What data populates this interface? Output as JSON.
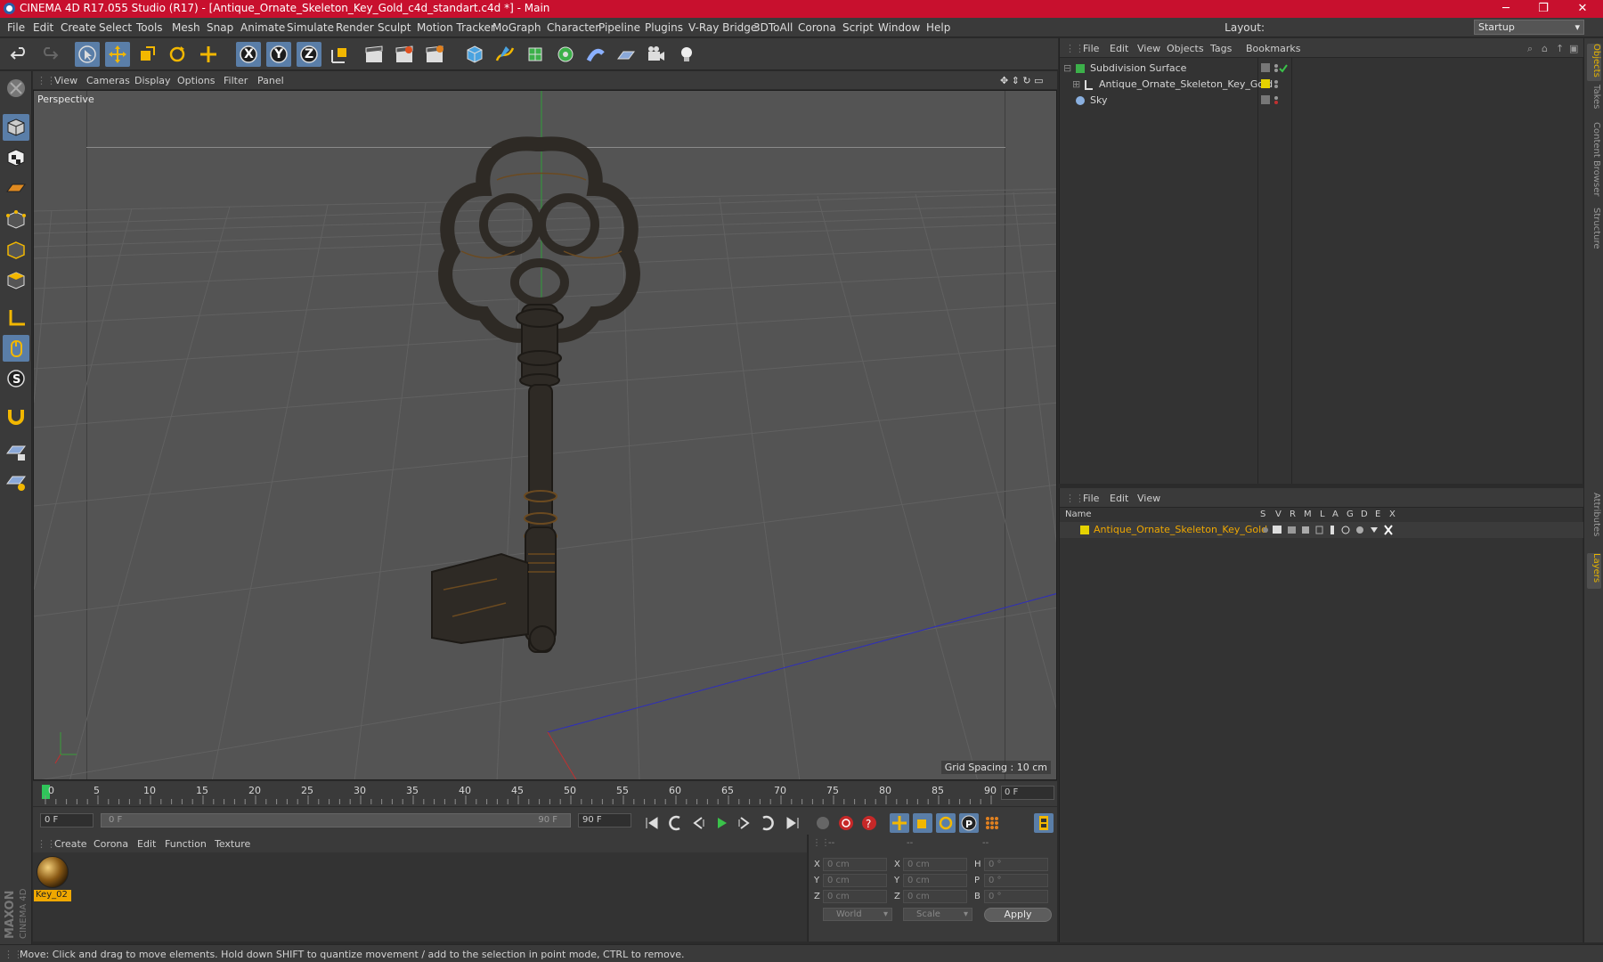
{
  "window": {
    "title": "CINEMA 4D R17.055 Studio (R17) - [Antique_Ornate_Skeleton_Key_Gold_c4d_standart.c4d *] - Main",
    "minimize": "─",
    "maximize": "❐",
    "close": "✕"
  },
  "menu": [
    "File",
    "Edit",
    "Create",
    "Select",
    "Tools",
    "Mesh",
    "Snap",
    "Animate",
    "Simulate",
    "Render",
    "Sculpt",
    "Motion Tracker",
    "MoGraph",
    "Character",
    "Pipeline",
    "Plugins",
    "V-Ray Bridge",
    "3DToAll",
    "Corona",
    "Script",
    "Window",
    "Help"
  ],
  "layout": {
    "label": "Layout:",
    "value": "Startup"
  },
  "toolbar": {
    "axis_x": "X",
    "axis_y": "Y",
    "axis_z": "Z"
  },
  "viewport": {
    "menu": [
      "View",
      "Cameras",
      "Display",
      "Options",
      "Filter",
      "Panel"
    ],
    "label": "Perspective",
    "grid_spacing": "Grid Spacing : 10 cm"
  },
  "timeline": {
    "ticks": [
      "0",
      "5",
      "10",
      "15",
      "20",
      "25",
      "30",
      "35",
      "40",
      "45",
      "50",
      "55",
      "60",
      "65",
      "70",
      "75",
      "80",
      "85",
      "90"
    ],
    "current_frame": "0 F",
    "start_frame": "0 F",
    "range_start": "0 F",
    "range_end": "90 F",
    "end_frame": "90 F"
  },
  "materials": {
    "menu": [
      "Create",
      "Corona",
      "Edit",
      "Function",
      "Texture"
    ],
    "items": [
      {
        "name": "Key_02"
      }
    ]
  },
  "coordinates": {
    "header": [
      "--",
      "--",
      "--"
    ],
    "rows": [
      {
        "a": "X",
        "av": "0 cm",
        "b": "X",
        "bv": "0 cm",
        "c": "H",
        "cv": "0 °"
      },
      {
        "a": "Y",
        "av": "0 cm",
        "b": "Y",
        "bv": "0 cm",
        "c": "P",
        "cv": "0 °"
      },
      {
        "a": "Z",
        "av": "0 cm",
        "b": "Z",
        "bv": "0 cm",
        "c": "B",
        "cv": "0 °"
      }
    ],
    "mode": "World",
    "scale": "Scale",
    "apply": "Apply"
  },
  "objects_panel": {
    "menu": [
      "File",
      "Edit",
      "View",
      "Objects",
      "Tags",
      "Bookmarks"
    ],
    "items": [
      {
        "name": "Subdivision Surface"
      },
      {
        "name": "Antique_Ornate_Skeleton_Key_Gold",
        "color": "#e5d200"
      },
      {
        "name": "Sky"
      }
    ]
  },
  "layers_panel": {
    "menu": [
      "File",
      "Edit",
      "View"
    ],
    "columns": [
      "Name",
      "S",
      "V",
      "R",
      "M",
      "L",
      "A",
      "G",
      "D",
      "E",
      "X"
    ],
    "items": [
      {
        "name": "Antique_Ornate_Skeleton_Key_Gold",
        "color": "#e5d200"
      }
    ]
  },
  "right_tabs": [
    "Objects",
    "Takes",
    "Content Browser",
    "Structure",
    "Attributes",
    "Layers"
  ],
  "status": "Move: Click and drag to move elements. Hold down SHIFT to quantize movement / add to the selection in point mode, CTRL to remove.",
  "brand": {
    "line1": "MAXON",
    "line2": "CINEMA 4D"
  },
  "colors": {
    "titlebar": "#c8102e",
    "selection": "#5a7ea8",
    "layer_highlight": "#f0a800"
  }
}
